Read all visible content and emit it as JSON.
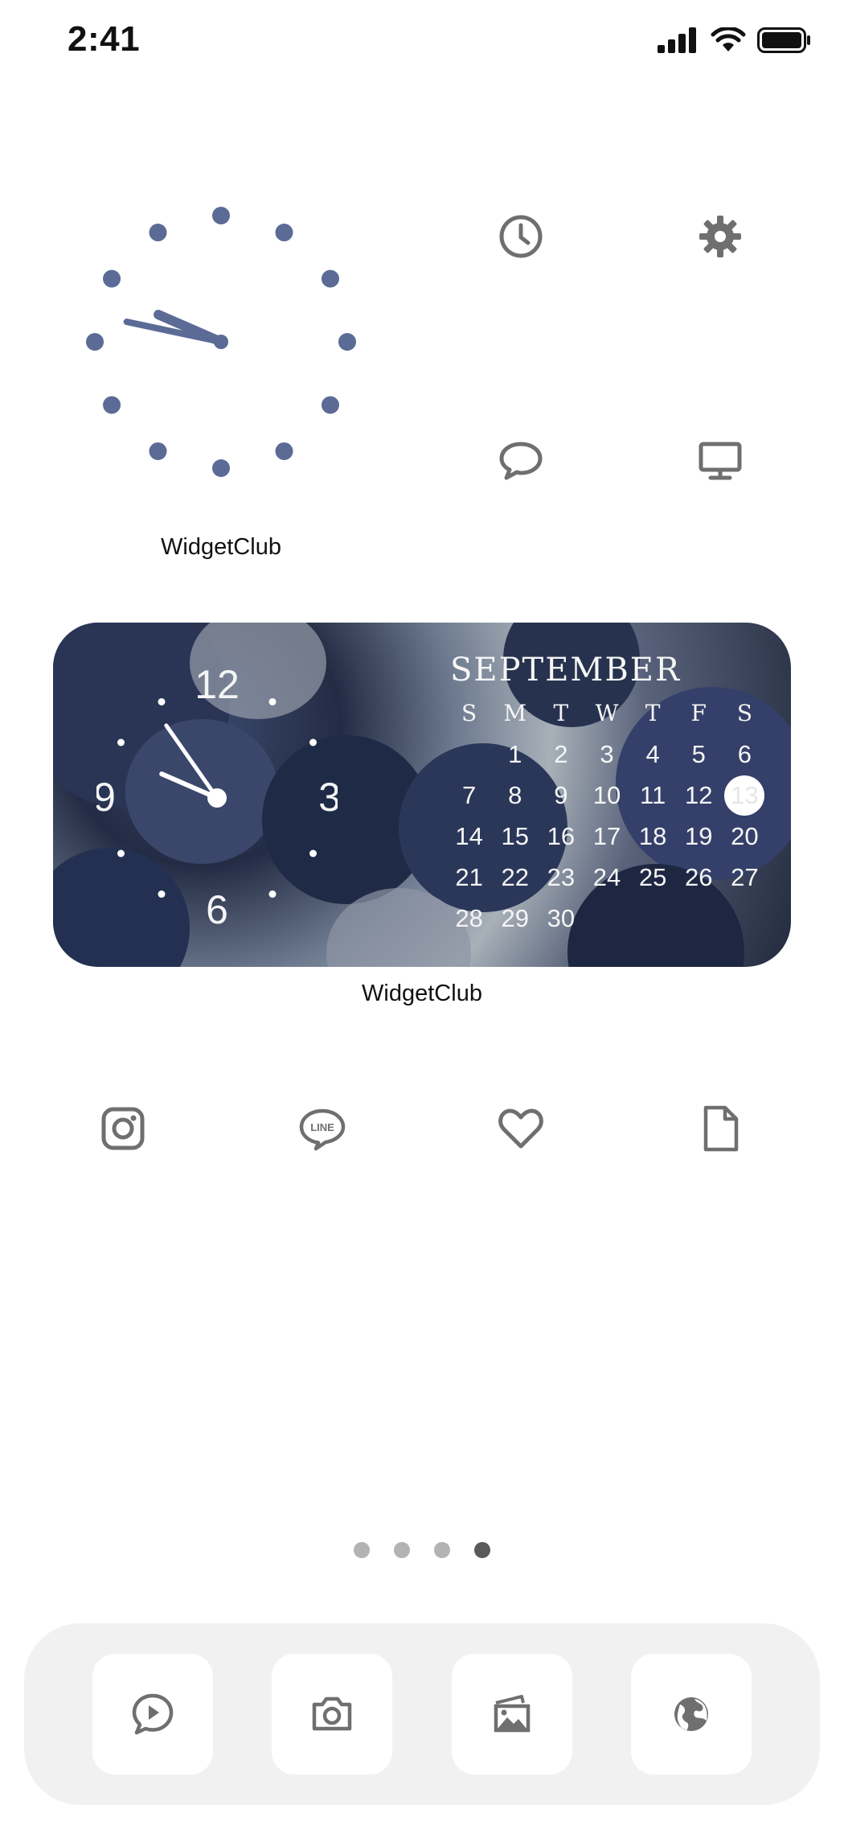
{
  "status_bar": {
    "time": "2:41"
  },
  "clock_widget": {
    "label": "WidgetClub",
    "hour": 9,
    "minute": 47,
    "color": "#5b6b96"
  },
  "top_icons": [
    {
      "name": "clock-icon"
    },
    {
      "name": "settings-icon"
    },
    {
      "name": "messages-icon"
    },
    {
      "name": "tv-icon"
    }
  ],
  "photo_widget": {
    "label": "WidgetClub",
    "clock_numerals": [
      "12",
      "3",
      "6",
      "9"
    ],
    "calendar": {
      "month": "SEPTEMBER",
      "weekdays": [
        "S",
        "M",
        "T",
        "W",
        "T",
        "F",
        "S"
      ],
      "leading_blanks": 1,
      "days": [
        "1",
        "2",
        "3",
        "4",
        "5",
        "6",
        "7",
        "8",
        "9",
        "10",
        "11",
        "12",
        "13",
        "14",
        "15",
        "16",
        "17",
        "18",
        "19",
        "20",
        "21",
        "22",
        "23",
        "24",
        "25",
        "26",
        "27",
        "28",
        "29",
        "30"
      ],
      "today": "13"
    }
  },
  "row_icons": [
    {
      "name": "instagram-icon"
    },
    {
      "name": "line-icon",
      "text": "LINE"
    },
    {
      "name": "heart-icon"
    },
    {
      "name": "file-icon"
    }
  ],
  "page_dots": {
    "count": 4,
    "active_index": 3
  },
  "dock": [
    {
      "name": "video-chat-icon"
    },
    {
      "name": "camera-icon"
    },
    {
      "name": "photos-icon"
    },
    {
      "name": "globe-icon"
    }
  ],
  "colors": {
    "icon_gray": "#6f6f6f",
    "clock_blue": "#5b6b96"
  }
}
